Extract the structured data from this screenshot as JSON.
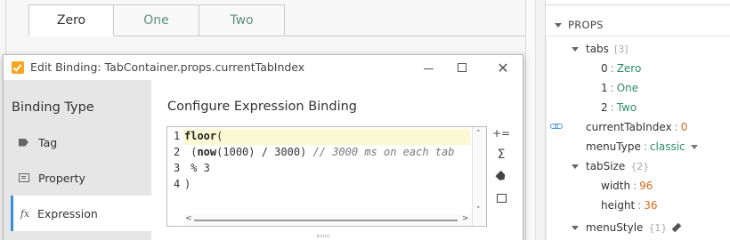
{
  "tab_container": {
    "tabs": [
      "Zero",
      "One",
      "Two"
    ],
    "active_index": 0
  },
  "dialog": {
    "title": "Edit Binding: TabContainer.props.currentTabIndex",
    "binding_type_heading": "Binding Type",
    "binding_types": [
      {
        "label": "Tag",
        "icon": "tag-icon",
        "selected": false
      },
      {
        "label": "Property",
        "icon": "property-icon",
        "selected": false
      },
      {
        "label": "Expression",
        "icon": "fx-icon",
        "selected": true
      }
    ],
    "fx_glyph": "fx",
    "configure_heading": "Configure Expression Binding",
    "editor": {
      "line_numbers": [
        "1",
        "2",
        "3",
        "4"
      ],
      "lines": {
        "l1_kw": "floor",
        "l1_rest": "(",
        "l2_pre": " (",
        "l2_kw": "now",
        "l2_rest": "(1000) / 3000) ",
        "l2_comment": "// 3000 ms on each tab",
        "l3": " % 3",
        "l4": ")"
      }
    },
    "toolbar_icons": [
      "insert-icon",
      "function-sigma-icon",
      "tag-icon",
      "property-icon"
    ],
    "toolbar_glyphs": {
      "insert": "+=",
      "sigma": "Σ"
    }
  },
  "props_panel": {
    "section_title": "PROPS",
    "rows": {
      "tabs_key": "tabs",
      "tabs_meta": "[3]",
      "tab0_key": "0",
      "tab0_val": "Zero",
      "tab1_key": "1",
      "tab1_val": "One",
      "tab2_key": "2",
      "tab2_val": "Two",
      "cti_key": "currentTabIndex",
      "cti_val": "0",
      "menutype_key": "menuType",
      "menutype_val": "classic",
      "tabsize_key": "tabSize",
      "tabsize_meta": "{2}",
      "width_key": "width",
      "width_val": "96",
      "height_key": "height",
      "height_val": "36",
      "menustyle_key": "menuStyle",
      "menustyle_meta": "{1}"
    },
    "colon": ":"
  },
  "colors": {
    "accent": "#3a8fd6",
    "string_value": "#2e8b6e",
    "number_value": "#d2691e",
    "current_line": "#fbf9d3"
  }
}
